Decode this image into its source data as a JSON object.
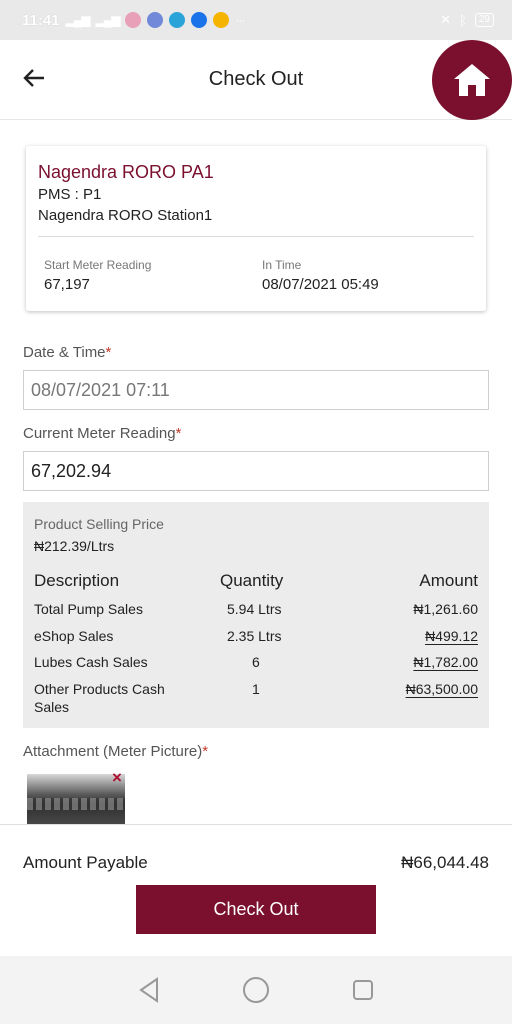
{
  "status_bar": {
    "time": "11:41",
    "battery": "29"
  },
  "header": {
    "title": "Check Out"
  },
  "station": {
    "name": "Nagendra RORO PA1",
    "pms": "PMS : P1",
    "station_name": "Nagendra RORO Station1",
    "start_meter_label": "Start Meter Reading",
    "start_meter_value": "67,197",
    "in_time_label": "In Time",
    "in_time_value": "08/07/2021 05:49"
  },
  "form": {
    "date_label": "Date & Time",
    "date_value": "08/07/2021 07:11",
    "meter_label": "Current Meter Reading",
    "meter_value": "67,202.94",
    "required_mark": "*"
  },
  "sales": {
    "price_label": "Product Selling Price",
    "price_value": "₦212.39/Ltrs",
    "headers": {
      "description": "Description",
      "quantity": "Quantity",
      "amount": "Amount"
    },
    "rows": [
      {
        "description": "Total Pump Sales",
        "quantity": "5.94 Ltrs",
        "amount": "₦1,261.60"
      },
      {
        "description": "eShop Sales",
        "quantity": "2.35 Ltrs",
        "amount": "₦499.12"
      },
      {
        "description": "Lubes Cash Sales",
        "quantity": "6",
        "amount": "₦1,782.00"
      },
      {
        "description": "Other Products Cash",
        "description2": "Sales",
        "quantity": "1",
        "amount": "₦63,500.00"
      }
    ]
  },
  "attachment": {
    "label": "Attachment (Meter Picture)",
    "remove_icon": "×"
  },
  "footer": {
    "amount_label": "Amount Payable",
    "amount_value": "₦66,044.48",
    "checkout_label": "Check Out"
  },
  "colors": {
    "brand": "#7a0f2e",
    "required": "#c0392b",
    "panel": "#ececec"
  }
}
